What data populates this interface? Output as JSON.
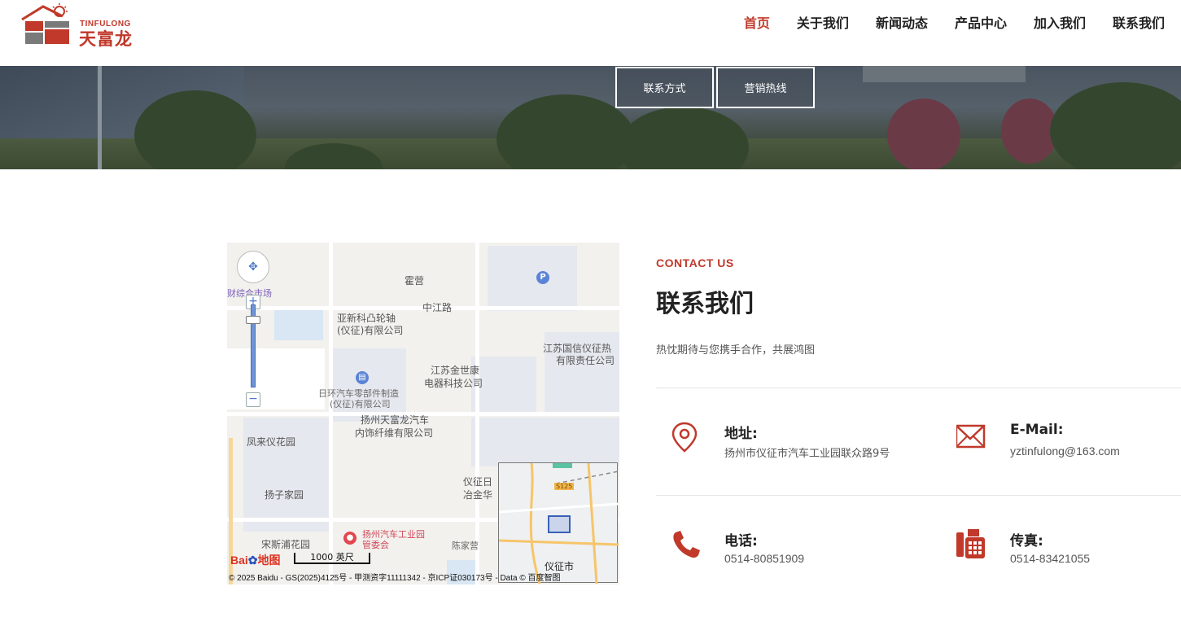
{
  "header": {
    "logo_en": "TINFULONG",
    "logo_cn": "天富龙",
    "nav": [
      {
        "label": "首页",
        "active": true
      },
      {
        "label": "关于我们",
        "active": false
      },
      {
        "label": "新闻动态",
        "active": false
      },
      {
        "label": "产品中心",
        "active": false
      },
      {
        "label": "加入我们",
        "active": false
      },
      {
        "label": "联系我们",
        "active": false
      }
    ]
  },
  "hero": {
    "tabs": [
      "联系方式",
      "营销热线"
    ]
  },
  "map": {
    "labels": {
      "huoying": "霍营",
      "zhongjiang": "中江路",
      "yaxinke_1": "亚新科凸轮轴",
      "yaxinke_2": "(仪征)有限公司",
      "jiangsuguoxin_1": "江苏国信仪征热",
      "jiangsuguoxin_2": "有限责任公司",
      "jinshikang_1": "江苏金世康",
      "jinshikang_2": "电器科技公司",
      "rihuan_1": "日环汽车零部件制造",
      "rihuan_2": "(仪征)有限公司",
      "tianfulong_1": "扬州天富龙汽车",
      "tianfulong_2": "内饰纤维有限公司",
      "fenglai": "凤来仪花园",
      "yangzi": "扬子家园",
      "songsipu": "宋斯浦花园",
      "yizheng_ri": "仪征日",
      "yezhi": "冶金华",
      "park_1": "扬州汽车工业园",
      "park_2": "管委会",
      "chenjiaying": "陈家营",
      "mall": "财综合市场",
      "mini_city": "仪征市",
      "mini_road": "S125"
    },
    "scale": "1000 英尺",
    "logo": "Bai du 地图",
    "copyright": "© 2025 Baidu - GS(2025)4125号 - 甲测资字11111342 - 京ICP证030173号 - Data © 百度智图"
  },
  "contact": {
    "eyebrow": "CONTACT US",
    "title": "联系我们",
    "desc": "热忱期待与您携手合作，共展鸿图",
    "address": {
      "label": "地址:",
      "value": "扬州市仪征市汽车工业园联众路9号"
    },
    "email": {
      "label": "E-Mail:",
      "value": "yztinfulong@163.com"
    },
    "phone": {
      "label": "电话:",
      "value": "0514-80851909"
    },
    "fax": {
      "label": "传真:",
      "value": "0514-83421055"
    }
  },
  "colors": {
    "accent": "#c0392b",
    "text": "#222222",
    "muted": "#555555"
  }
}
